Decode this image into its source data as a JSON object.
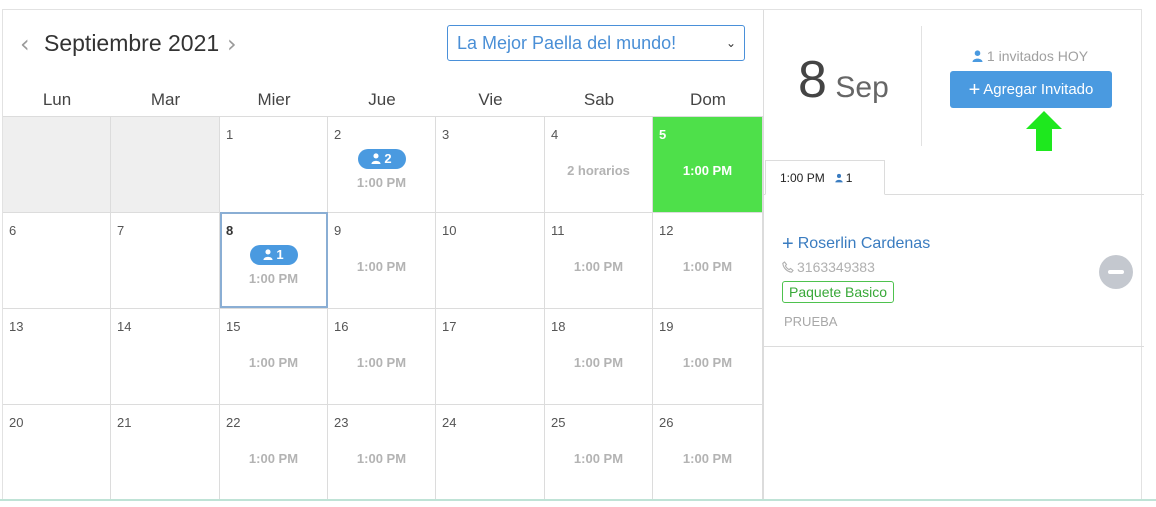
{
  "calendar": {
    "month_title": "Septiembre 2021",
    "prev_icon": "chevron-left-icon",
    "next_icon": "chevron-right-icon",
    "event_select": "La Mejor Paella del mundo!",
    "weekdays": [
      "Lun",
      "Mar",
      "Mier",
      "Jue",
      "Vie",
      "Sab",
      "Dom"
    ],
    "weeks": [
      [
        {
          "day": "",
          "state": "disabled"
        },
        {
          "day": "",
          "state": "disabled"
        },
        {
          "day": "1"
        },
        {
          "day": "2",
          "badge": "2",
          "time": "1:00 PM"
        },
        {
          "day": "3"
        },
        {
          "day": "4",
          "time": "2 horarios"
        },
        {
          "day": "5",
          "time": "1:00 PM",
          "state": "green"
        }
      ],
      [
        {
          "day": "6"
        },
        {
          "day": "7"
        },
        {
          "day": "8",
          "badge": "1",
          "time": "1:00 PM",
          "state": "selected"
        },
        {
          "day": "9",
          "time": "1:00 PM"
        },
        {
          "day": "10"
        },
        {
          "day": "11",
          "time": "1:00 PM"
        },
        {
          "day": "12",
          "time": "1:00 PM"
        }
      ],
      [
        {
          "day": "13"
        },
        {
          "day": "14"
        },
        {
          "day": "15",
          "time": "1:00 PM"
        },
        {
          "day": "16",
          "time": "1:00 PM"
        },
        {
          "day": "17"
        },
        {
          "day": "18",
          "time": "1:00 PM"
        },
        {
          "day": "19",
          "time": "1:00 PM"
        }
      ],
      [
        {
          "day": "20"
        },
        {
          "day": "21"
        },
        {
          "day": "22",
          "time": "1:00 PM"
        },
        {
          "day": "23",
          "time": "1:00 PM"
        },
        {
          "day": "24"
        },
        {
          "day": "25",
          "time": "1:00 PM"
        },
        {
          "day": "26",
          "time": "1:00 PM"
        }
      ]
    ]
  },
  "panel": {
    "day": "8",
    "month": "Sep",
    "invited_today": "1 invitados HOY",
    "add_button": "Agregar Invitado",
    "arrow_color": "#1ee81e",
    "tab_time": "1:00 PM",
    "tab_count": "1",
    "guest": {
      "name": "Roserlin Cardenas",
      "phone": "3163349383",
      "package": "Paquete Basico",
      "note": "PRUEBA"
    }
  },
  "colors": {
    "accent": "#4a9ae0",
    "available_day": "#4ee04a",
    "package_border": "#4ec24e"
  }
}
